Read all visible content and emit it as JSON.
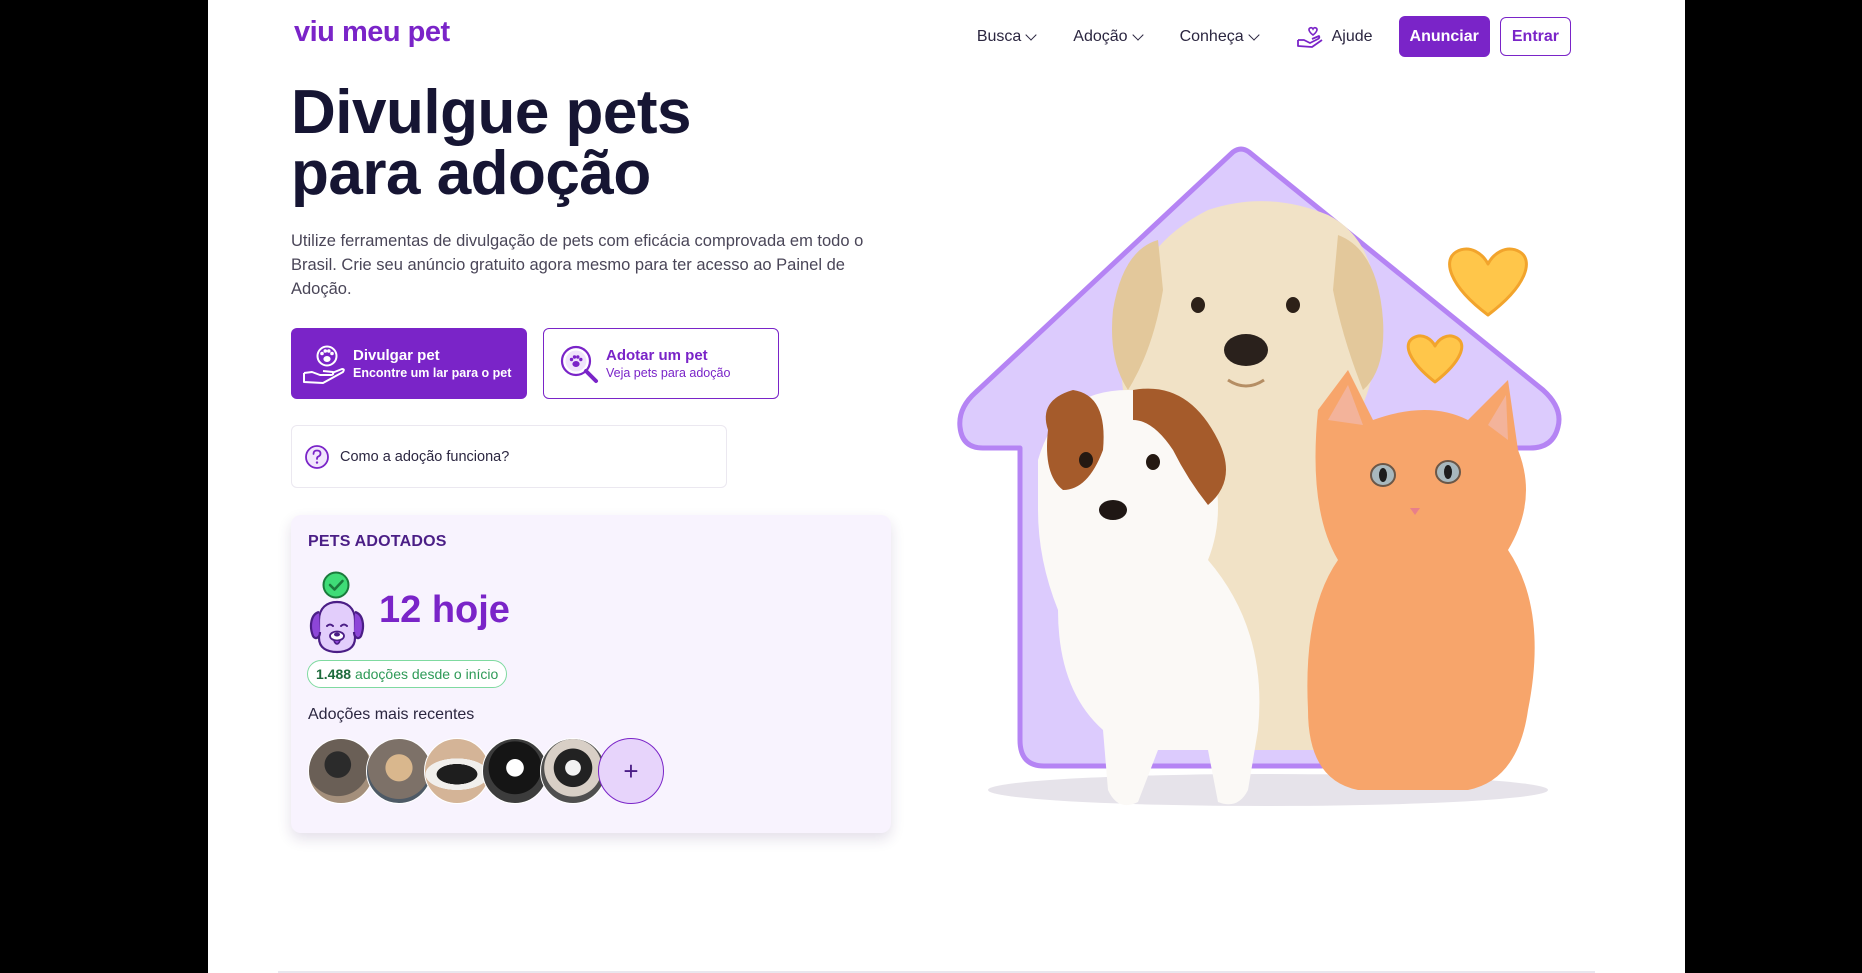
{
  "header": {
    "logo": "viu meu pet",
    "nav": [
      {
        "label": "Busca"
      },
      {
        "label": "Adoção"
      },
      {
        "label": "Conheça"
      }
    ],
    "help_label": "Ajude",
    "cta_label": "Anunciar",
    "login_label": "Entrar"
  },
  "hero": {
    "title_line1": "Divulgue pets",
    "title_line2": "para adoção",
    "description": "Utilize ferramentas de divulgação de pets com eficácia comprovada em todo o Brasil. Crie seu anúncio gratuito agora mesmo para ter acesso ao Painel de Adoção.",
    "primary_cta": {
      "title": "Divulgar pet",
      "subtitle": "Encontre um lar para o pet",
      "icon": "paw-hand-icon"
    },
    "secondary_cta": {
      "title": "Adotar um pet",
      "subtitle": "Veja pets para adoção",
      "icon": "paw-search-icon"
    },
    "how_it_works": "Como a adoção funciona?"
  },
  "adopted": {
    "title": "PETS ADOTADOS",
    "today": "12 hoje",
    "total": "1.488",
    "total_suffix": "adoções desde o início",
    "recent_label": "Adoções mais recentes",
    "more_symbol": "+"
  },
  "colors": {
    "brand": "#7a24c8",
    "dark": "#161533",
    "house": "#dccbfd",
    "heart": "#ffc64a"
  }
}
